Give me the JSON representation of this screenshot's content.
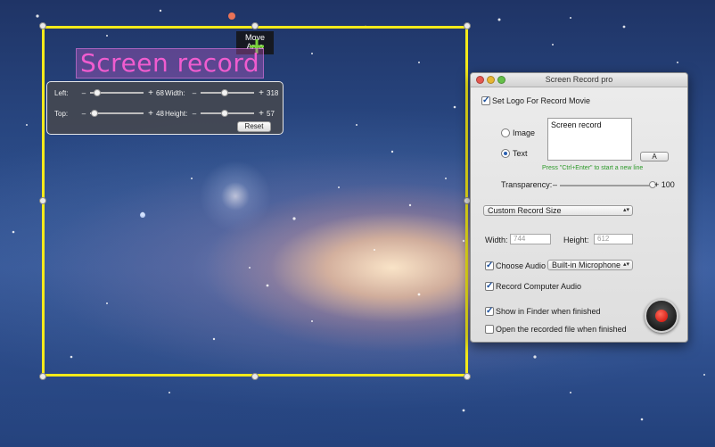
{
  "move_area": {
    "label": "Move Area"
  },
  "logo_overlay": {
    "text": "Screen record",
    "color": "#f05ccf"
  },
  "position_panel": {
    "left": {
      "label": "Left:",
      "value": "68",
      "fraction": 0.13
    },
    "top": {
      "label": "Top:",
      "value": "48",
      "fraction": 0.09
    },
    "width": {
      "label": "Width:",
      "value": "318",
      "fraction": 0.45
    },
    "height": {
      "label": "Height:",
      "value": "57",
      "fraction": 0.45
    },
    "minus_glyph": "–",
    "plus_glyph": "+",
    "reset_label": "Reset"
  },
  "window": {
    "title": "Screen Record pro",
    "set_logo": {
      "label": "Set Logo For Record Movie",
      "checked": true
    },
    "image_option": {
      "label": "Image",
      "selected": false
    },
    "text_option": {
      "label": "Text",
      "selected": true
    },
    "logo_text_value": "Screen record",
    "font_button_label": "A",
    "hint": "Press \"Ctrl+Enter\" to start a new line",
    "transparency": {
      "label": "Transparency:",
      "minus": "–",
      "max_label": "+ 100",
      "value": 100
    },
    "record_size": {
      "selected": "Custom Record Size"
    },
    "width": {
      "label": "Width:",
      "value": "744"
    },
    "height": {
      "label": "Height:",
      "value": "612"
    },
    "choose_audio": {
      "label": "Choose Audio",
      "checked": true,
      "selected": "Built-in Microphone"
    },
    "record_computer_audio": {
      "label": "Record Computer Audio",
      "checked": true
    },
    "show_in_finder": {
      "label": "Show in Finder when finished",
      "checked": true
    },
    "open_recorded": {
      "label": "Open the recorded file when finished",
      "checked": false
    }
  },
  "colors": {
    "capture_frame": "#f4ea1a",
    "record_red": "#d9241a",
    "hint_green": "#2d9a2a"
  },
  "icons": [
    "move-cross-icon",
    "record-icon",
    "close-icon",
    "minimize-icon",
    "zoom-icon"
  ]
}
